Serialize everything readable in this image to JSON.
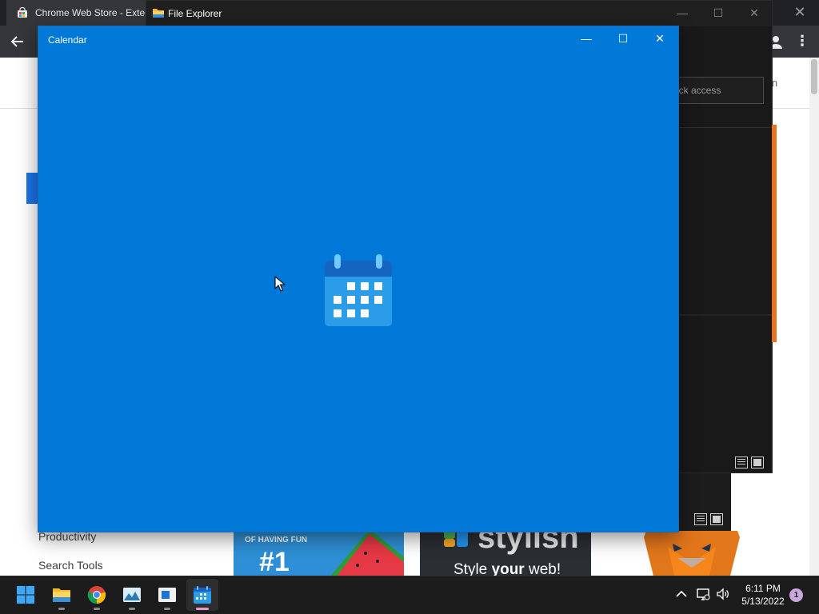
{
  "chrome": {
    "tab_title": "Chrome Web Store - Exter",
    "sign_in_partial": "in",
    "sidebar_categories": [
      "Productivity",
      "Search Tools"
    ],
    "tiles": {
      "fruit_text_1": "OF HAVING FUN",
      "fruit_text_2": "#1",
      "stylish_logo": "stylish",
      "stylish_tagline_a": "Style ",
      "stylish_tagline_b": "your",
      "stylish_tagline_c": " web!"
    }
  },
  "explorer": {
    "title": "File Explorer",
    "search_placeholder": "ick access",
    "controls": {
      "minimize": "—",
      "maximize": "☐",
      "close": "✕"
    }
  },
  "calendar": {
    "title": "Calendar",
    "accent_color": "#0078d7",
    "controls": {
      "minimize": "—",
      "maximize": "☐",
      "close": "✕"
    }
  },
  "taskbar": {
    "apps": [
      "start-icon",
      "file-explorer-icon",
      "chrome-icon",
      "photos-icon",
      "store-icon",
      "calendar-icon"
    ],
    "clock_time": "6:11 PM",
    "clock_date": "5/13/2022",
    "notification_count": "1"
  }
}
